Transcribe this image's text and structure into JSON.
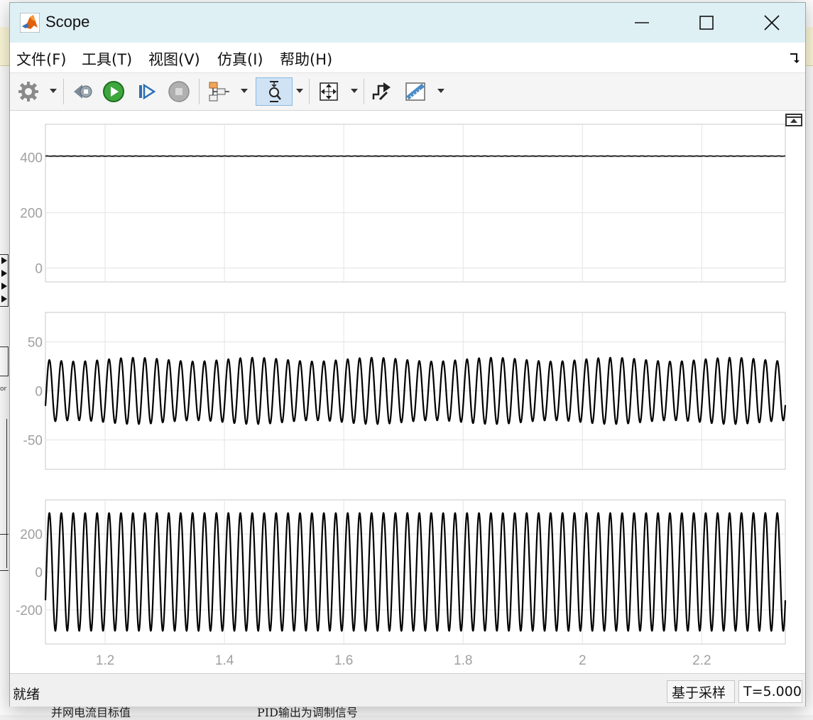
{
  "background": {
    "labels": [
      "并网电流目标值",
      "PID输出为调制信号"
    ],
    "side_text": "or"
  },
  "window": {
    "title": "Scope",
    "icon": "matlab-logo-icon",
    "controls": [
      "minimize-icon",
      "maximize-icon",
      "close-icon"
    ]
  },
  "menu": [
    {
      "label": "文件(F)",
      "accel": "F"
    },
    {
      "label": "工具(T)",
      "accel": "T"
    },
    {
      "label": "视图(V)",
      "accel": "V"
    },
    {
      "label": "仿真(I)",
      "accel": "I"
    },
    {
      "label": "帮助(H)",
      "accel": "H"
    }
  ],
  "toolbar": {
    "buttons": [
      "settings-gear-icon",
      "step-back-icon",
      "run-icon",
      "step-forward-icon",
      "stop-icon",
      "signal-select-icon",
      "zoom-y-icon",
      "autoscale-icon",
      "triggers-icon",
      "cursor-measure-icon"
    ],
    "active": "zoom-y-icon"
  },
  "plots": {
    "x_ticks": [
      "1.2",
      "1.4",
      "1.6",
      "1.8",
      "2",
      "2.2"
    ],
    "xlim": [
      1.1,
      2.34
    ],
    "line_color": "#000000",
    "grid_color": "#e3e3e3",
    "tick_label_color": "#a0a0a0"
  },
  "chart_data": [
    {
      "type": "line",
      "y_ticks": [
        "400",
        "200",
        "0"
      ],
      "ylim": [
        -50,
        520
      ],
      "x": [
        1.1,
        2.34
      ],
      "series": [
        {
          "values": [
            405,
            405
          ],
          "description_level": 405
        }
      ],
      "grid": true
    },
    {
      "type": "line",
      "y_ticks": [
        "50",
        "0",
        "-50"
      ],
      "ylim": [
        -80,
        80
      ],
      "x_range": [
        1.1,
        2.34
      ],
      "series": [
        {
          "amplitude": 32,
          "frequency_hz": 50
        }
      ],
      "grid": true
    },
    {
      "type": "line",
      "y_ticks": [
        "200",
        "0",
        "-200"
      ],
      "ylim": [
        -380,
        380
      ],
      "x_range": [
        1.1,
        2.34
      ],
      "series": [
        {
          "amplitude": 311,
          "frequency_hz": 50
        }
      ],
      "grid": true
    }
  ],
  "status": {
    "text": "就绪",
    "mode": "基于采样",
    "time": "T=5.000"
  }
}
